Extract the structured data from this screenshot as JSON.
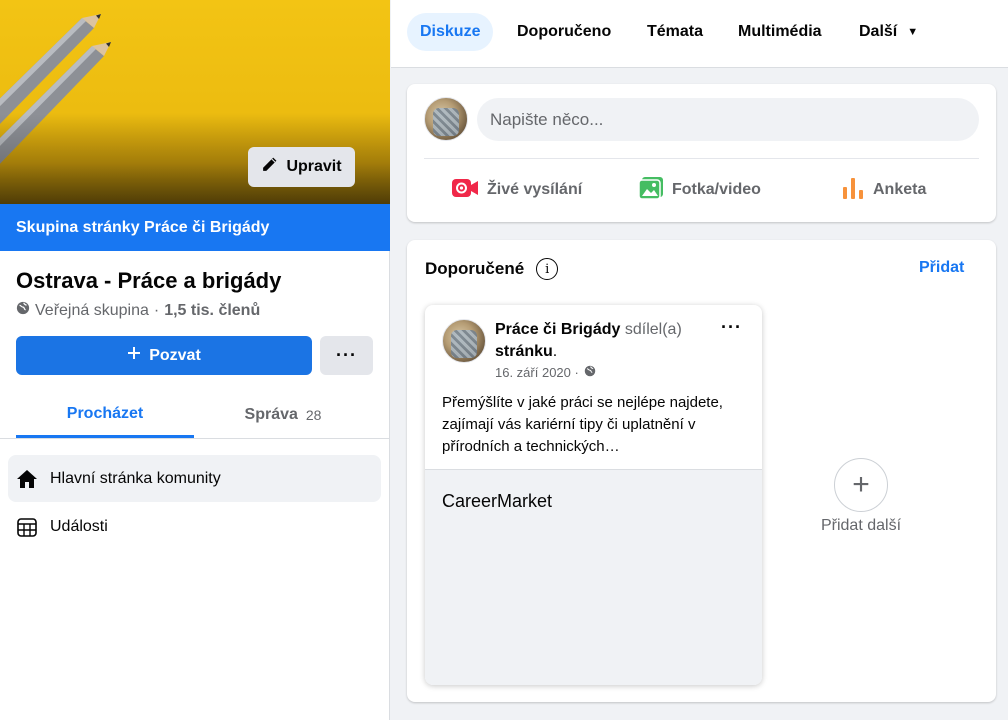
{
  "sidebar": {
    "edit_label": "Upravit",
    "page_banner": "Skupina stránky Práce či Brigády",
    "group_name": "Ostrava - Práce a brigády",
    "group_privacy": "Veřejná skupina",
    "group_separator": "·",
    "group_members": "1,5 tis. členů",
    "invite_label": "Pozvat",
    "more_label": "···",
    "tabs": [
      {
        "label": "Procházet",
        "count": ""
      },
      {
        "label": "Správa",
        "count": "28"
      }
    ],
    "nav": [
      {
        "label": "Hlavní stránka komunity",
        "icon": "home-icon"
      },
      {
        "label": "Události",
        "icon": "calendar-icon"
      }
    ]
  },
  "topbar": {
    "tabs": [
      {
        "label": "Diskuze"
      },
      {
        "label": "Doporučeno"
      },
      {
        "label": "Témata"
      },
      {
        "label": "Multimédia"
      },
      {
        "label": "Další"
      }
    ]
  },
  "composer": {
    "placeholder": "Napište něco...",
    "actions": [
      {
        "label": "Živé vysílání",
        "icon": "live-video-icon",
        "color": "#f02849"
      },
      {
        "label": "Fotka/video",
        "icon": "photo-video-icon",
        "color": "#45bd62"
      },
      {
        "label": "Anketa",
        "icon": "poll-icon",
        "color": "#f7923b"
      }
    ]
  },
  "recommended": {
    "title": "Doporučené",
    "add_label": "Přidat",
    "post": {
      "author": "Práce či Brigády",
      "action": "sdílel(a)",
      "object": "stránku",
      "period": ".",
      "date": "16. září 2020 ·",
      "body": "Přemýšlíte v jaké práci se nejlépe najdete, zajímají vás kariérní tipy či uplatnění v přírodních a technických…",
      "link_title": "CareerMarket",
      "menu": "···"
    },
    "add_more_label": "Přidat další",
    "add_more_symbol": "+"
  },
  "colors": {
    "accent": "#1877f2",
    "cover": "#f3c414"
  }
}
